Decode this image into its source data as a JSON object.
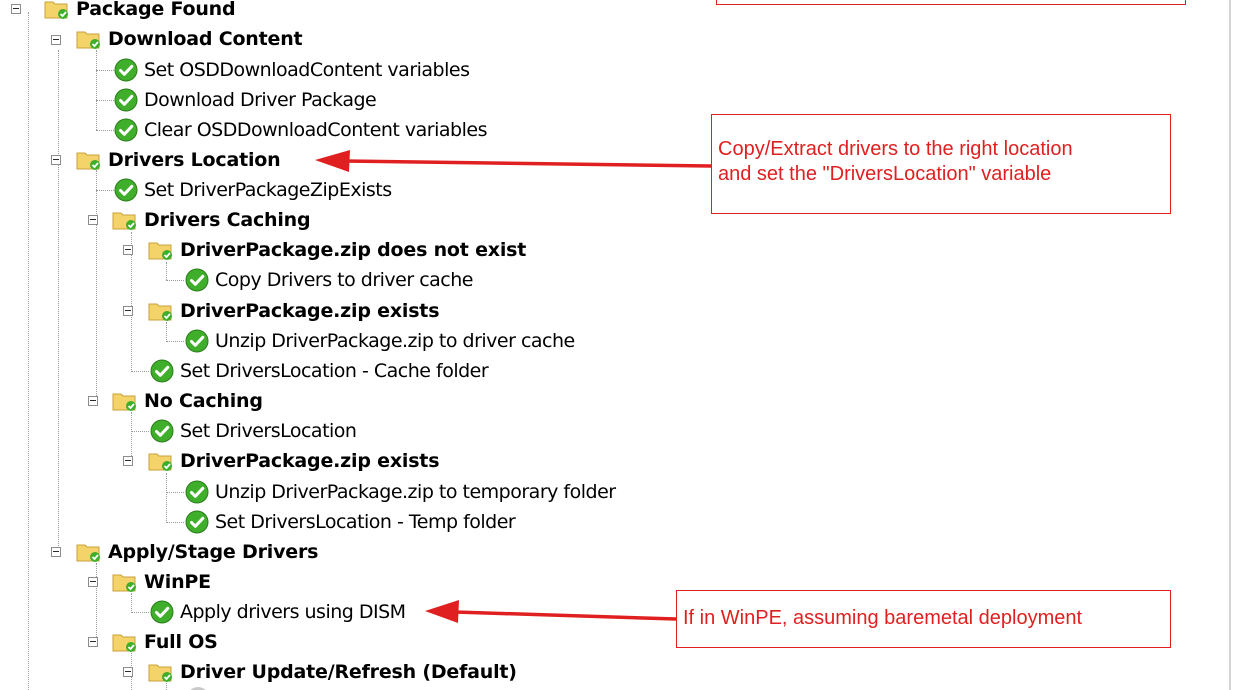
{
  "tree": {
    "items": [
      {
        "label": "Package Found",
        "type": "group"
      },
      {
        "label": "Download Content",
        "type": "group"
      },
      {
        "label": "Set OSDDownloadContent variables",
        "type": "step"
      },
      {
        "label": "Download Driver Package",
        "type": "step"
      },
      {
        "label": "Clear OSDDownloadContent variables",
        "type": "step"
      },
      {
        "label": "Drivers Location",
        "type": "group"
      },
      {
        "label": "Set DriverPackageZipExists",
        "type": "step"
      },
      {
        "label": "Drivers Caching",
        "type": "group"
      },
      {
        "label": "DriverPackage.zip does not exist",
        "type": "group"
      },
      {
        "label": "Copy Drivers to driver cache",
        "type": "step"
      },
      {
        "label": "DriverPackage.zip exists",
        "type": "group"
      },
      {
        "label": "Unzip DriverPackage.zip to driver cache",
        "type": "step"
      },
      {
        "label": "Set DriversLocation - Cache folder",
        "type": "step"
      },
      {
        "label": "No Caching",
        "type": "group"
      },
      {
        "label": "Set DriversLocation",
        "type": "step"
      },
      {
        "label": "DriverPackage.zip exists",
        "type": "group"
      },
      {
        "label": "Unzip DriverPackage.zip to temporary folder",
        "type": "step"
      },
      {
        "label": "Set DriversLocation - Temp folder",
        "type": "step"
      },
      {
        "label": "Apply/Stage Drivers",
        "type": "group"
      },
      {
        "label": "WinPE",
        "type": "group"
      },
      {
        "label": "Apply drivers using DISM",
        "type": "step"
      },
      {
        "label": "Full OS",
        "type": "group"
      },
      {
        "label": "Driver Update/Refresh (Default)",
        "type": "group"
      }
    ]
  },
  "annotations": {
    "drivers_location_note": {
      "line1": "Copy/Extract drivers to the right location",
      "line2": "and set the \"DriversLocation\" variable"
    },
    "winpe_note": {
      "text": "If in WinPE, assuming baremetal deployment"
    }
  },
  "colors": {
    "annotation": "#e02020",
    "success_green": "#3fae2a",
    "folder_yellow": "#f4d36a"
  }
}
